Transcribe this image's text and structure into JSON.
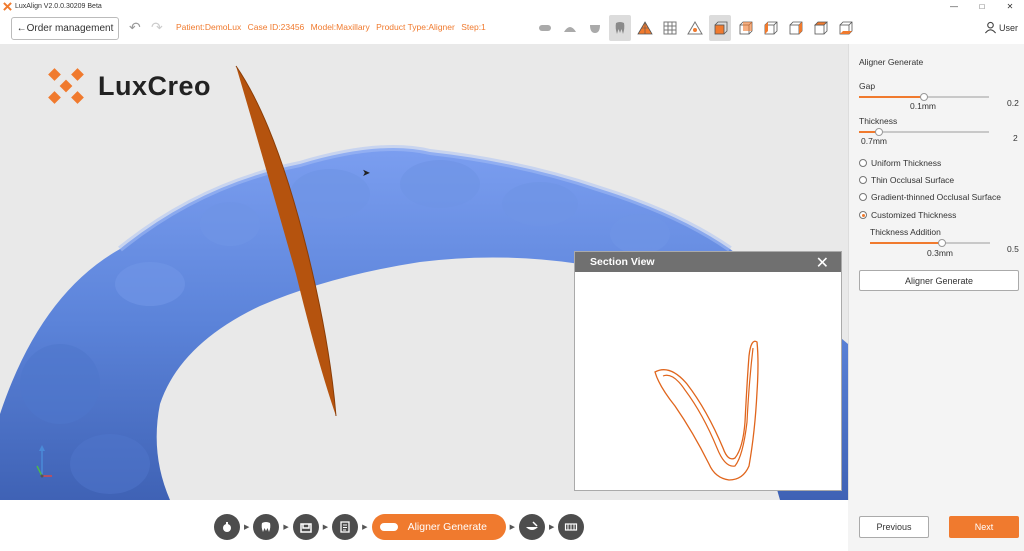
{
  "window": {
    "title": "LuxAlign V2.0.0.30209 Beta",
    "controls": [
      "—",
      "□",
      "✕"
    ]
  },
  "toolbar": {
    "order_management": "←Order management",
    "undo_glyph": "↶",
    "redo_glyph": "↷",
    "case_info": [
      "Patient:DemoLux",
      "Case ID:23456",
      "Model:Maxillary",
      "Product Type:Aligner",
      "Step:1"
    ],
    "user_label": "User"
  },
  "brand": {
    "name": "LuxCreo",
    "color": "#f07a2e"
  },
  "section_view": {
    "title": "Section View",
    "close_glyph": "✕"
  },
  "panel": {
    "title": "Aligner Generate",
    "gap": {
      "label": "Gap",
      "value": "0.1mm",
      "max": "0.2",
      "fraction": 0.5
    },
    "thickness": {
      "label": "Thickness",
      "value": "0.7mm",
      "max": "2",
      "fraction": 0.15
    },
    "options": [
      {
        "label": "Uniform Thickness",
        "checked": false
      },
      {
        "label": "Thin Occlusal Surface",
        "checked": false
      },
      {
        "label": "Gradient-thinned Occlusal Surface",
        "checked": false
      },
      {
        "label": "Customized Thickness",
        "checked": true
      }
    ],
    "thickness_addition": {
      "label": "Thickness Addition",
      "value": "0.3mm",
      "max": "0.5",
      "fraction": 0.6
    },
    "generate_button": "Aligner Generate"
  },
  "workflow": {
    "active_step": "Aligner Generate",
    "arrow_glyph": "▶"
  },
  "nav": {
    "previous": "Previous",
    "next": "Next"
  },
  "colors": {
    "accent": "#f07a2e",
    "model": "#5b83d9",
    "plane": "#b5530e"
  }
}
